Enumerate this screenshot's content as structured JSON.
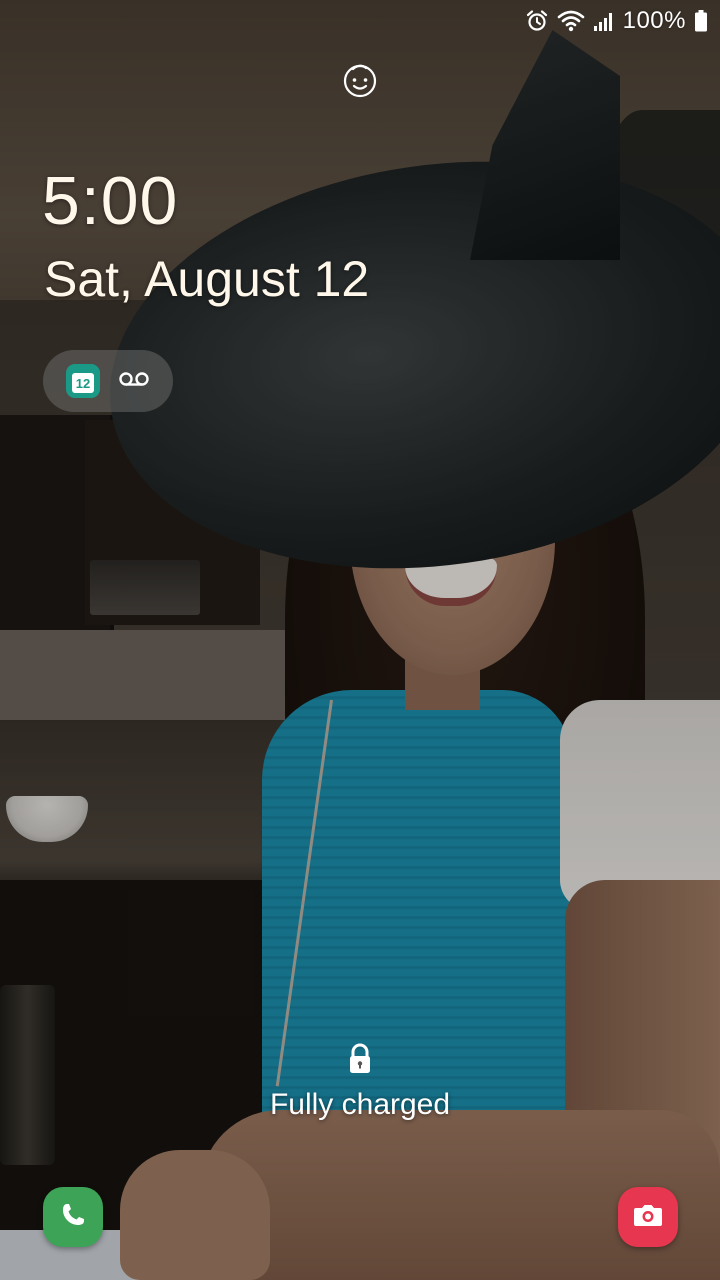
{
  "status_bar": {
    "battery_percent": "100%",
    "icons": [
      "alarm-icon",
      "wifi-icon",
      "cellular-signal-icon",
      "battery-icon"
    ]
  },
  "lock_screen": {
    "time": "5:00",
    "date": "Sat, August 12",
    "notifications": [
      {
        "icon": "calendar-icon",
        "label": "12"
      },
      {
        "icon": "voicemail-icon"
      }
    ],
    "charge_status": "Fully charged",
    "shortcuts": {
      "left": {
        "icon": "phone-icon",
        "color": "#3da457"
      },
      "right": {
        "icon": "camera-icon",
        "color": "#e63650"
      }
    }
  },
  "colors": {
    "clock_text": "#fff8ea",
    "calendar_accent": "#1a9a86"
  }
}
